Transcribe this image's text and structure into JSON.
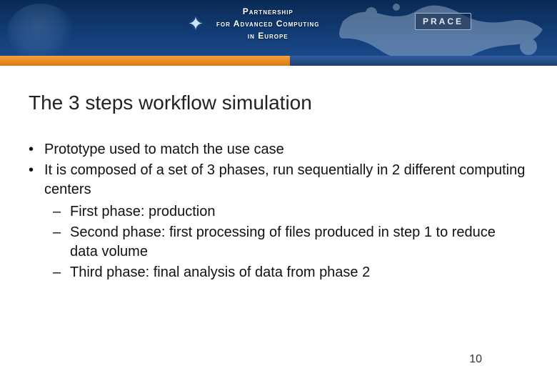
{
  "header": {
    "org_line1": "Partnership",
    "org_line2": "for Advanced Computing",
    "org_line3": "in Europe",
    "prace_label": "PRACE"
  },
  "title": "The 3 steps workflow simulation",
  "bullets": [
    "Prototype used to match the use case",
    "It is composed of a set of 3 phases, run sequentially in 2 different computing centers"
  ],
  "sub_bullets": [
    "First phase: production",
    "Second phase: first processing of files produced in step 1 to reduce data volume",
    "Third phase: final analysis of data from phase 2"
  ],
  "page_number": "10"
}
